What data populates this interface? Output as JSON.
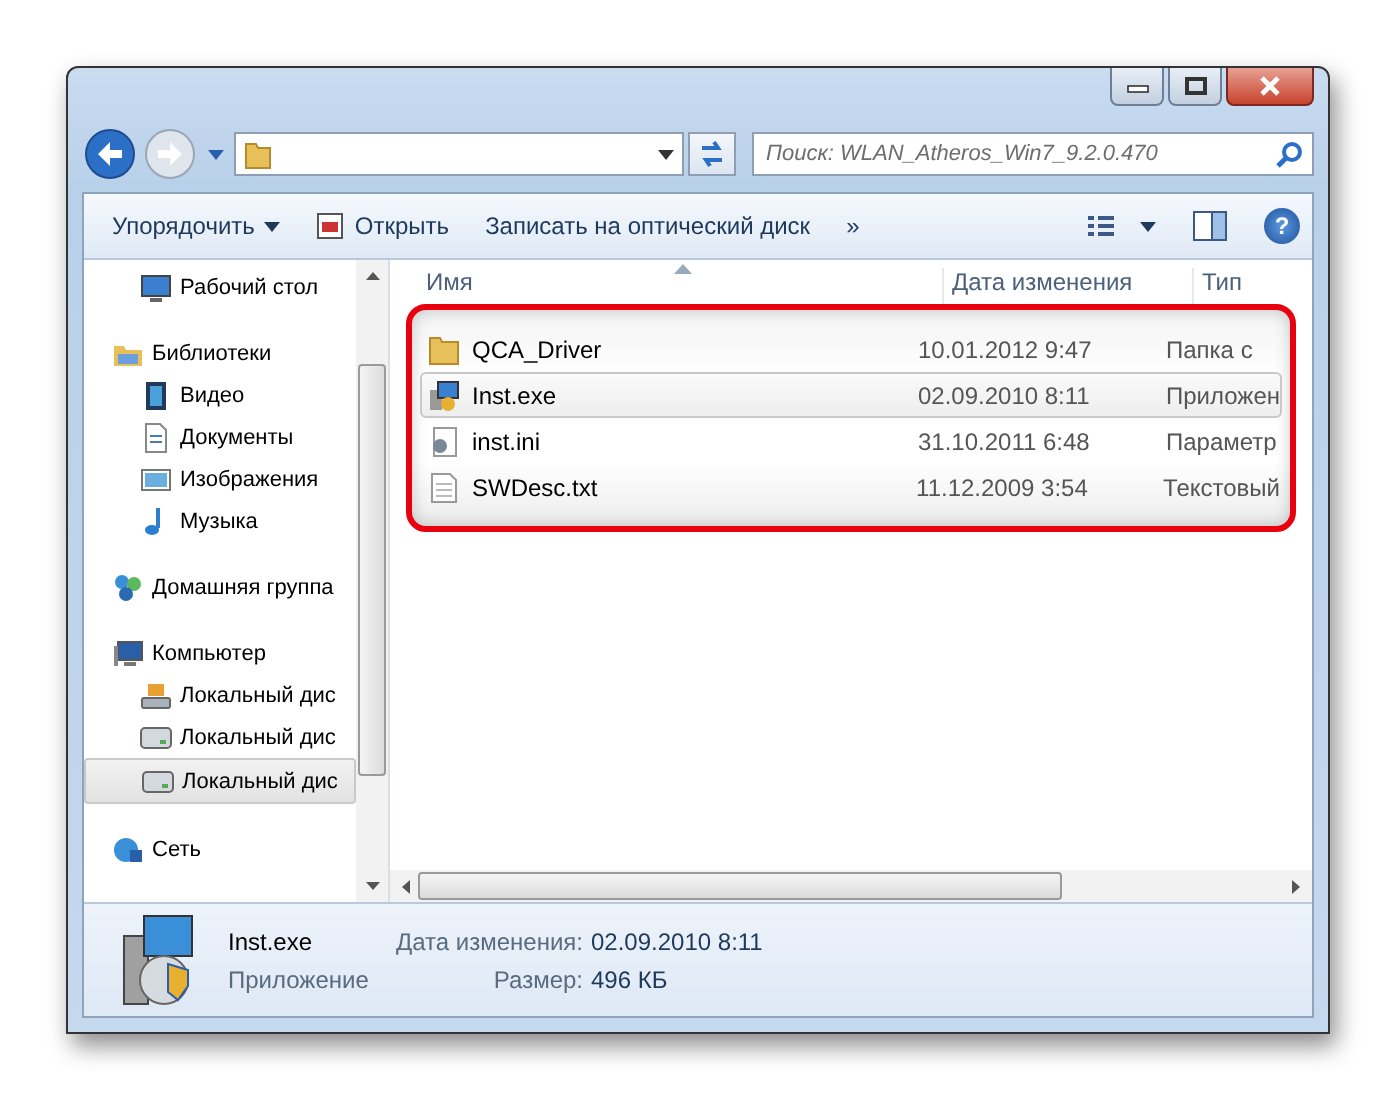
{
  "address_bar": {
    "search": {
      "placeholder": "Поиск: WLAN_Atheros_Win7_9.2.0.470"
    }
  },
  "toolbar": {
    "organize": "Упорядочить",
    "open": "Открыть",
    "burn": "Записать на оптический диск",
    "more": "»",
    "help": "?"
  },
  "sidebar": {
    "sections": [
      {
        "children": [
          {
            "label": "Рабочий стол",
            "kind": "desktop",
            "selected": false
          }
        ]
      },
      {
        "label": "Библиотеки",
        "kind": "libraries",
        "selected": false,
        "children": [
          {
            "label": "Видео",
            "kind": "video",
            "selected": false
          },
          {
            "label": "Документы",
            "kind": "documents",
            "selected": false
          },
          {
            "label": "Изображения",
            "kind": "images",
            "selected": false
          },
          {
            "label": "Музыка",
            "kind": "music",
            "selected": false
          }
        ]
      },
      {
        "label": "Домашняя группа",
        "kind": "homegroup",
        "selected": false
      },
      {
        "label": "Компьютер",
        "kind": "computer",
        "selected": false,
        "children": [
          {
            "label": "Локальный дис",
            "kind": "system-drive",
            "selected": false
          },
          {
            "label": "Локальный дис",
            "kind": "drive",
            "selected": false
          },
          {
            "label": "Локальный дис",
            "kind": "drive",
            "selected": true
          }
        ]
      },
      {
        "label": "Сеть",
        "kind": "network",
        "selected": false
      }
    ]
  },
  "table": {
    "columns": [
      "Имя",
      "Дата изменения",
      "Тип"
    ],
    "rows": [
      {
        "name": "QCA_Driver",
        "date": "10.01.2012 9:47",
        "type": "Папка с",
        "kind": "folder",
        "selected": false
      },
      {
        "name": "Inst.exe",
        "date": "02.09.2010 8:11",
        "type": "Приложен",
        "kind": "installer",
        "selected": true
      },
      {
        "name": "inst.ini",
        "date": "31.10.2011 6:48",
        "type": "Параметр",
        "kind": "settings",
        "selected": false
      },
      {
        "name": "SWDesc.txt",
        "date": "11.12.2009 3:54",
        "type": "Текстовый",
        "kind": "text",
        "selected": false
      }
    ]
  },
  "details": {
    "name": "Inst.exe",
    "type": "Приложение",
    "fields": [
      {
        "label": "Дата изменения:",
        "value": "02.09.2010 8:11"
      },
      {
        "label": "Размер:",
        "value": "496 КБ"
      }
    ]
  }
}
